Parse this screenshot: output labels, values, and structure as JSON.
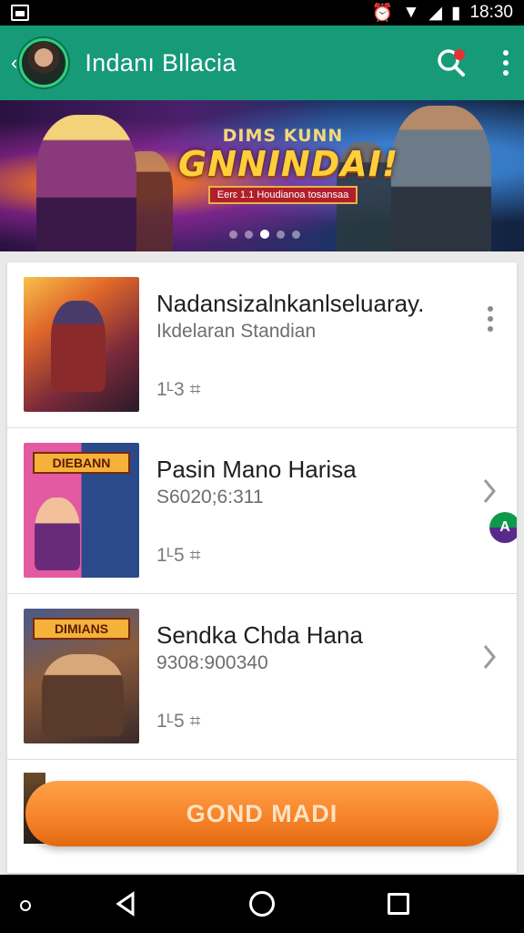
{
  "status_bar": {
    "time": "18:30",
    "icons": [
      "notification-icon",
      "alarm-icon",
      "wifi-icon",
      "signal-icon",
      "battery-icon"
    ]
  },
  "app_bar": {
    "title": "Indanı Bllacia",
    "back_icon": "chevron-left-icon",
    "search_icon": "search-icon",
    "more_icon": "more-vertical-icon",
    "accent": "#169a78"
  },
  "banner": {
    "subtitle": "DIMS KUNN",
    "title": "GNNINDAI!",
    "tag": "Eerɛ 1.1 Houdianoa tosansaa",
    "page_count": 5,
    "active_page": 2
  },
  "list": {
    "items": [
      {
        "title": "Nadansizalnkanlseluaray.",
        "subtitle": "Ikdelaran Standian",
        "meta": "1ᴸ3 ⌗",
        "trailing": "more-vertical-icon",
        "thumb_logo": ""
      },
      {
        "title": "Pasin Mano Harisa",
        "subtitle": "S6020;6:311",
        "meta": "1ᴸ5 ⌗",
        "trailing": "chevron-right-icon",
        "thumb_logo": "DIEBANN"
      },
      {
        "title": "Sendka Chda Hana",
        "subtitle": "9308:900340",
        "meta": "1ᴸ5 ⌗",
        "trailing": "chevron-right-icon",
        "thumb_logo": "DIMIANS"
      }
    ]
  },
  "cta": {
    "label": "GOND MADI",
    "color": "#f7842a"
  },
  "nav_bar": {
    "icons": [
      "nav-dot-icon",
      "back-triangle-icon",
      "home-circle-icon",
      "recents-square-icon"
    ]
  }
}
